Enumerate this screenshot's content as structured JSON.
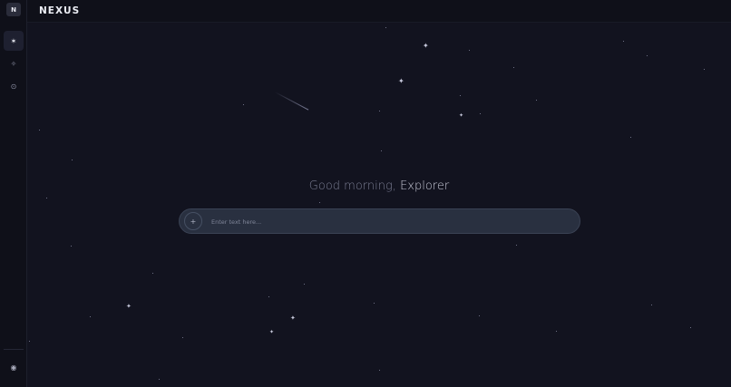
{
  "sidebar": {
    "logo_letter": "N",
    "buttons": [
      {
        "icon": "sparkle-icon",
        "glyph": "✶"
      },
      {
        "icon": "diamond-star-icon",
        "glyph": "✧"
      },
      {
        "icon": "compass-icon",
        "glyph": "⊙"
      }
    ],
    "profile_glyph": "◉"
  },
  "header": {
    "brand": "NEXUS"
  },
  "main": {
    "greeting_prefix": "Good morning,",
    "greeting_name": "Explorer",
    "input": {
      "placeholder": "Enter text here...",
      "value": "",
      "add_glyph": "+"
    }
  },
  "colors": {
    "background": "#12131f",
    "sidebar": "#0f1019",
    "input_bg": "#293040",
    "accent_text": "#c9cbd8"
  }
}
